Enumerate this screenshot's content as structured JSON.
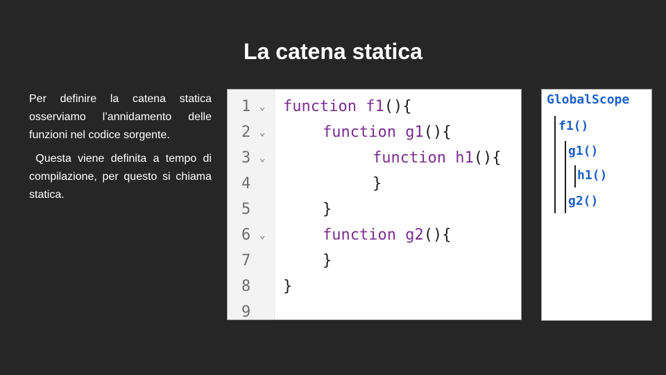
{
  "slide": {
    "title": "La catena statica",
    "paragraphs": [
      "Per definire la catena statica osserviamo l’annidamento delle funzioni nel codice sorgente.",
      " Questa viene definita a tempo di compilazione, per questo si chiama statica."
    ]
  },
  "code": {
    "lines": [
      {
        "num": "1",
        "fold": "⌄",
        "kw": "function",
        "name": "f1",
        "rest": "(){",
        "indent": 0
      },
      {
        "num": "2",
        "fold": "⌄",
        "kw": "function",
        "name": "g1",
        "rest": "(){",
        "indent": 1
      },
      {
        "num": "3",
        "fold": "⌄",
        "kw": "function",
        "name": "h1",
        "rest": "(){",
        "indent": 2
      },
      {
        "num": "4",
        "fold": "",
        "kw": "",
        "name": "",
        "rest": "}",
        "indent": 2
      },
      {
        "num": "5",
        "fold": "",
        "kw": "",
        "name": "",
        "rest": "}",
        "indent": 1
      },
      {
        "num": "6",
        "fold": "⌄",
        "kw": "function",
        "name": "g2",
        "rest": "(){",
        "indent": 1
      },
      {
        "num": "7",
        "fold": "",
        "kw": "",
        "name": "",
        "rest": "}",
        "indent": 1
      },
      {
        "num": "8",
        "fold": "",
        "kw": "",
        "name": "",
        "rest": "}",
        "indent": 0
      },
      {
        "num": "9",
        "fold": "",
        "kw": "",
        "name": "",
        "rest": "",
        "indent": 0
      }
    ]
  },
  "scope_tree": {
    "root": "GlobalScope",
    "f1": "f1()",
    "g1": "g1()",
    "h1": "h1()",
    "g2": "g2()"
  },
  "colors": {
    "background": "#262626",
    "keyword": "#7a2f8f",
    "scope_text": "#1c5fc9"
  }
}
